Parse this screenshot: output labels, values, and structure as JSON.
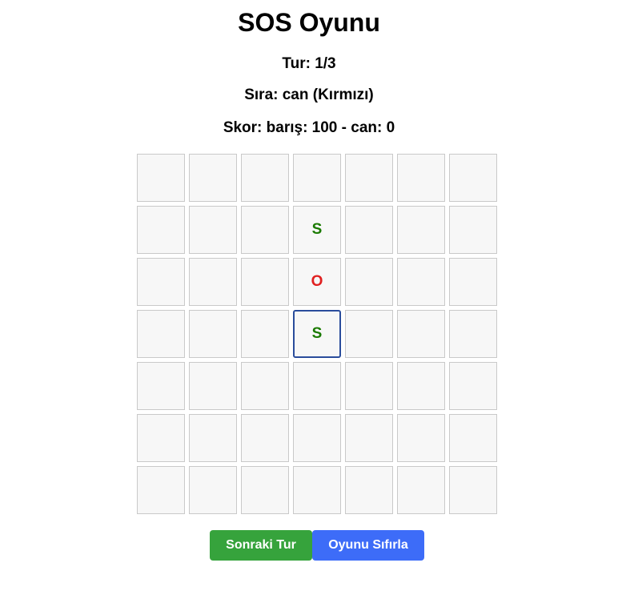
{
  "title": "SOS Oyunu",
  "turn_text": "Tur: 1/3",
  "current_player_text": "Sıra: can (Kırmızı)",
  "score_text": "Skor: barış: 100 - can: 0",
  "colors": {
    "green": "#1a7a00",
    "red": "#e02020",
    "next_button": "#36a33c",
    "reset_button": "#3d6cf8",
    "selected_border": "#2a4d9c"
  },
  "board": {
    "rows": 7,
    "cols": 7,
    "selected": [
      3,
      3
    ],
    "cells": [
      [
        "",
        "",
        "",
        "",
        "",
        "",
        ""
      ],
      [
        "",
        "",
        "",
        "S",
        "",
        "",
        ""
      ],
      [
        "",
        "",
        "",
        "O",
        "",
        "",
        ""
      ],
      [
        "",
        "",
        "",
        "S",
        "",
        "",
        ""
      ],
      [
        "",
        "",
        "",
        "",
        "",
        "",
        ""
      ],
      [
        "",
        "",
        "",
        "",
        "",
        "",
        ""
      ],
      [
        "",
        "",
        "",
        "",
        "",
        "",
        ""
      ]
    ],
    "cell_colors": [
      [
        "",
        "",
        "",
        "",
        "",
        "",
        ""
      ],
      [
        "",
        "",
        "",
        "green",
        "",
        "",
        ""
      ],
      [
        "",
        "",
        "",
        "red",
        "",
        "",
        ""
      ],
      [
        "",
        "",
        "",
        "green",
        "",
        "",
        ""
      ],
      [
        "",
        "",
        "",
        "",
        "",
        "",
        ""
      ],
      [
        "",
        "",
        "",
        "",
        "",
        "",
        ""
      ],
      [
        "",
        "",
        "",
        "",
        "",
        "",
        ""
      ]
    ]
  },
  "buttons": {
    "next_round": "Sonraki Tur",
    "reset_game": "Oyunu Sıfırla"
  }
}
